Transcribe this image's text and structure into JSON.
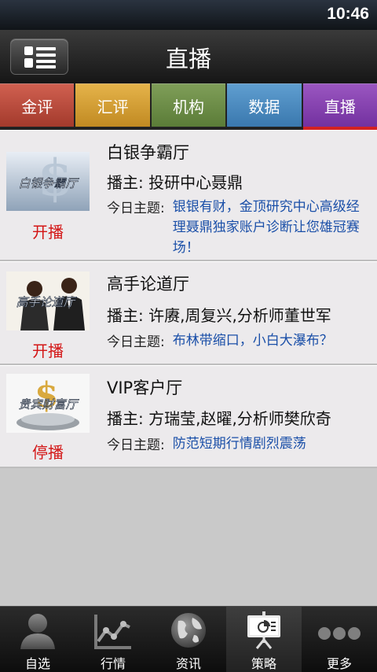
{
  "status_bar": {
    "time": "10:46"
  },
  "header": {
    "title": "直播"
  },
  "tabs": [
    {
      "label": "金评"
    },
    {
      "label": "汇评"
    },
    {
      "label": "机构"
    },
    {
      "label": "数据"
    },
    {
      "label": "直播"
    }
  ],
  "rooms": [
    {
      "name": "白银争霸厅",
      "thumb_text": "白银争霸厅",
      "host": "播主: 投研中心聂鼎",
      "topic_label": "今日主题:",
      "topic": "银银有财，金顶研究中心高级经理聂鼎独家账户诊断让您雄冠赛场！",
      "status": "开播"
    },
    {
      "name": "高手论道厅",
      "thumb_text": "高手论道厅",
      "host": "播主: 许赓,周复兴,分析师董世军",
      "topic_label": "今日主题:",
      "topic": "布林带缩口，小白大瀑布？",
      "status": "开播"
    },
    {
      "name": "VIP客户厅",
      "thumb_text": "贵宾财富厅",
      "host": "播主: 方瑞莹,赵曜,分析师樊欣奇",
      "topic_label": "今日主题:",
      "topic": "防范短期行情剧烈震荡",
      "status": "停播"
    }
  ],
  "bottom_nav": [
    {
      "label": "自选",
      "icon": "person-icon"
    },
    {
      "label": "行情",
      "icon": "chart-icon"
    },
    {
      "label": "资讯",
      "icon": "globe-icon"
    },
    {
      "label": "策略",
      "icon": "presentation-icon"
    },
    {
      "label": "更多",
      "icon": "more-dots-icon"
    }
  ],
  "colors": {
    "topic_text": "#1a4fa8",
    "status_text": "#d31515",
    "active_tab": "#7331a0",
    "active_tab_underline": "#d42222"
  }
}
